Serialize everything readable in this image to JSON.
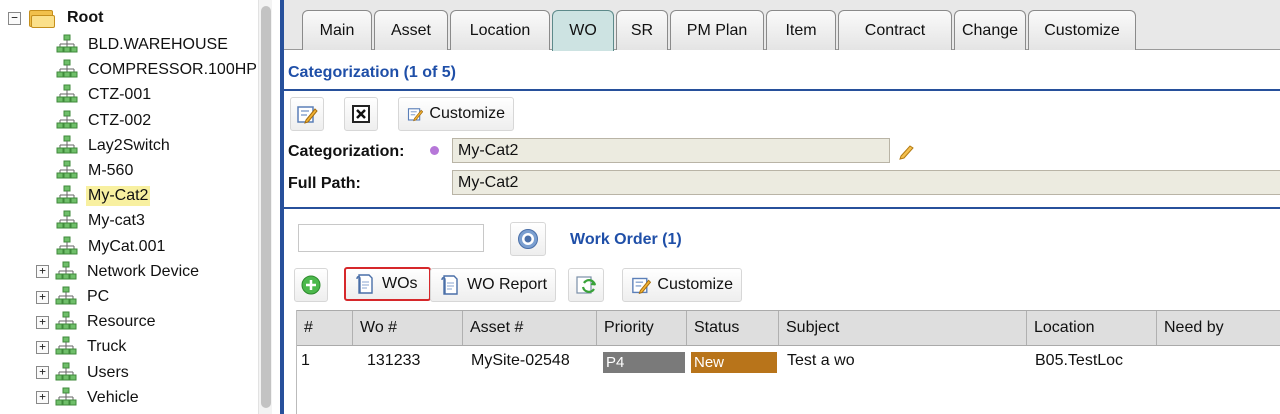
{
  "tree": {
    "root_label": "Root",
    "items": [
      {
        "label": "BLD.WAREHOUSE",
        "expandable": false,
        "selected": false
      },
      {
        "label": "COMPRESSOR.100HP",
        "expandable": false,
        "selected": false
      },
      {
        "label": "CTZ-001",
        "expandable": false,
        "selected": false
      },
      {
        "label": "CTZ-002",
        "expandable": false,
        "selected": false
      },
      {
        "label": "Lay2Switch",
        "expandable": false,
        "selected": false
      },
      {
        "label": "M-560",
        "expandable": false,
        "selected": false
      },
      {
        "label": "My-Cat2",
        "expandable": false,
        "selected": true
      },
      {
        "label": "My-cat3",
        "expandable": false,
        "selected": false
      },
      {
        "label": "MyCat.001",
        "expandable": false,
        "selected": false
      },
      {
        "label": "Network Device",
        "expandable": true,
        "selected": false
      },
      {
        "label": "PC",
        "expandable": true,
        "selected": false
      },
      {
        "label": "Resource",
        "expandable": true,
        "selected": false
      },
      {
        "label": "Truck",
        "expandable": true,
        "selected": false
      },
      {
        "label": "Users",
        "expandable": true,
        "selected": false
      },
      {
        "label": "Vehicle",
        "expandable": true,
        "selected": false
      }
    ],
    "collapse_glyph": "−",
    "expand_glyph": "+"
  },
  "tabs": [
    {
      "label": "Main",
      "active": false
    },
    {
      "label": "Asset",
      "active": false
    },
    {
      "label": "Location",
      "active": false
    },
    {
      "label": "WO",
      "active": true
    },
    {
      "label": "SR",
      "active": false
    },
    {
      "label": "PM Plan",
      "active": false
    },
    {
      "label": "Item",
      "active": false
    },
    {
      "label": "Contract",
      "active": false
    },
    {
      "label": "Change",
      "active": false
    },
    {
      "label": "Customize",
      "active": false
    }
  ],
  "categorization": {
    "title": "Categorization (1 of 5)",
    "toolbar": {
      "customize_label": "Customize"
    },
    "fields": {
      "categorization_label": "Categorization:",
      "categorization_value": "My-Cat2",
      "full_path_label": "Full Path:",
      "full_path_value": "My-Cat2"
    }
  },
  "work_orders": {
    "search_placeholder": "",
    "title": "Work Order (1)",
    "toolbar": {
      "wos_label": "WOs",
      "wo_report_label": "WO Report",
      "customize_label": "Customize"
    },
    "columns": [
      "#",
      "Wo #",
      "Asset #",
      "Priority",
      "Status",
      "Subject",
      "Location",
      "Need by"
    ],
    "rows": [
      {
        "num": "1",
        "wo": "131233",
        "asset": "MySite-02548",
        "priority": "P4",
        "status": "New",
        "subject": "Test a wo",
        "location": "B05.TestLoc",
        "need_by": ""
      }
    ]
  },
  "colors": {
    "accent_blue": "#1f4fa8",
    "priority_bg": "#7a7a7a",
    "status_new_bg": "#b8741a",
    "highlight_box": "#d6282b",
    "selected_tree_bg": "#f8f0a0"
  },
  "icons": {
    "edit": "edit-icon",
    "delete": "delete-icon",
    "customize": "customize-icon",
    "help": "help-icon",
    "add": "add-icon",
    "document": "document-icon",
    "refresh": "refresh-icon",
    "pencil": "pencil-icon"
  }
}
